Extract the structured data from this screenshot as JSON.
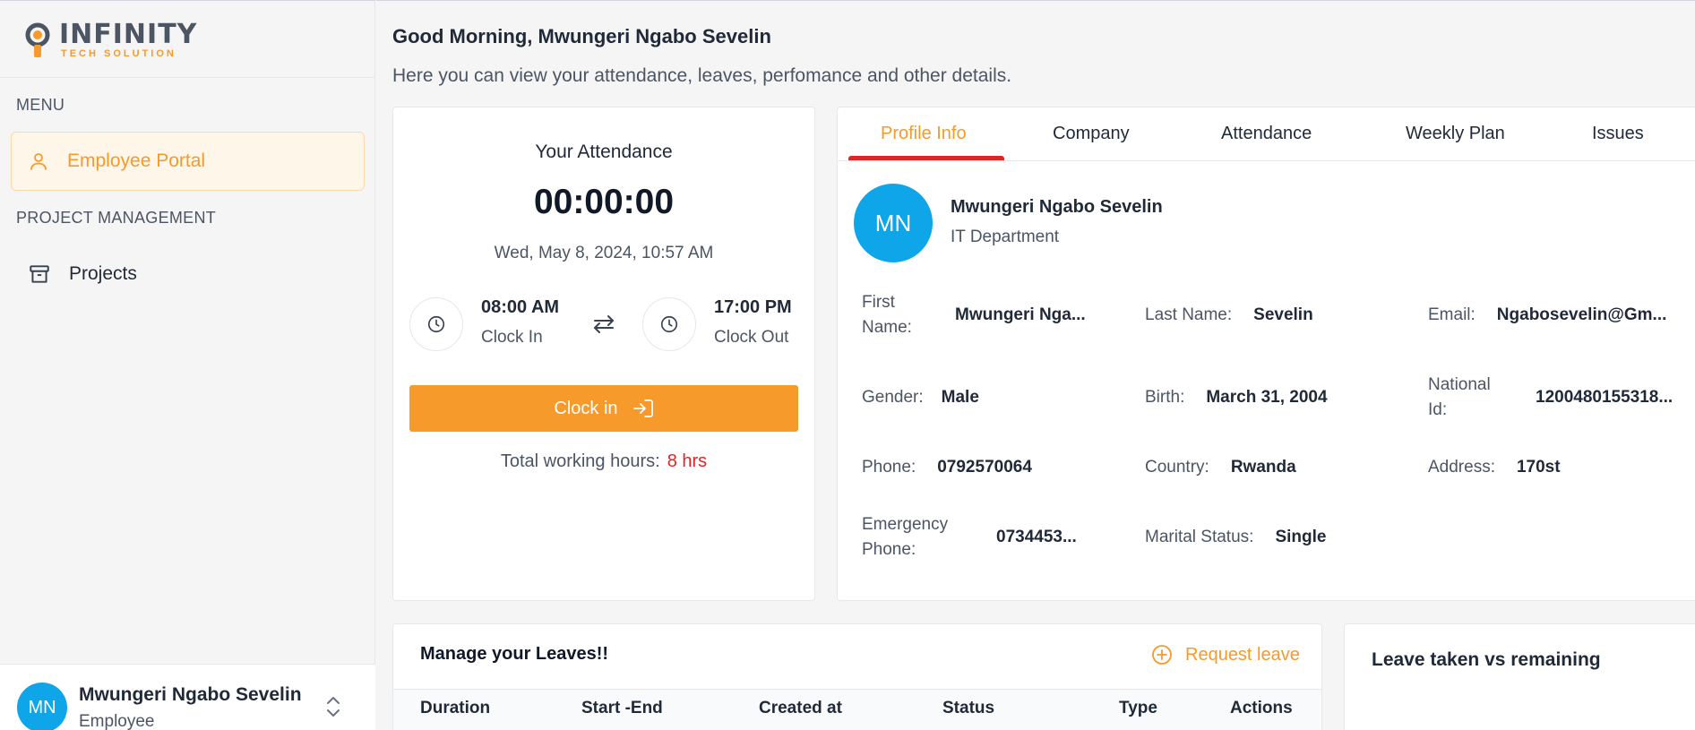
{
  "brand": {
    "name": "INFINITY",
    "tagline": "TECH SOLUTION"
  },
  "sidebar": {
    "menu_heading": "MENU",
    "project_heading": "PROJECT MANAGEMENT",
    "items": [
      {
        "label": "Employee Portal",
        "icon": "user-icon",
        "active": true
      },
      {
        "label": "Projects",
        "icon": "archive-icon",
        "active": false
      }
    ],
    "user": {
      "initials": "MN",
      "name": "Mwungeri Ngabo Sevelin",
      "role": "Employee"
    }
  },
  "header": {
    "greeting": "Good Morning, Mwungeri Ngabo Sevelin",
    "subtitle": "Here you can view your attendance, leaves, perfomance and other details."
  },
  "attendance": {
    "title": "Your Attendance",
    "timer": "00:00:00",
    "date": "Wed, May 8, 2024, 10:57 AM",
    "clock_in_time": "08:00 AM",
    "clock_in_label": "Clock In",
    "clock_out_time": "17:00 PM",
    "clock_out_label": "Clock Out",
    "button_label": "Clock in",
    "total_label": "Total working hours:",
    "total_value": "8 hrs"
  },
  "profile": {
    "tabs": [
      "Profile Info",
      "Company",
      "Attendance",
      "Weekly Plan",
      "Issues"
    ],
    "active_tab": "Profile Info",
    "initials": "MN",
    "name": "Mwungeri Ngabo Sevelin",
    "department": "IT Department",
    "fields": {
      "first_name": {
        "label": "First Name:",
        "value": "Mwungeri Nga..."
      },
      "last_name": {
        "label": "Last Name:",
        "value": "Sevelin"
      },
      "email": {
        "label": "Email:",
        "value": "Ngabosevelin@Gm..."
      },
      "gender": {
        "label": "Gender:",
        "value": "Male"
      },
      "birth": {
        "label": "Birth:",
        "value": "March 31, 2004"
      },
      "national_id": {
        "label": "National Id:",
        "value": "1200480155318..."
      },
      "phone": {
        "label": "Phone:",
        "value": "0792570064"
      },
      "country": {
        "label": "Country:",
        "value": "Rwanda"
      },
      "address": {
        "label": "Address:",
        "value": "170st"
      },
      "emergency_phone": {
        "label": "Emergency Phone:",
        "value": "0734453..."
      },
      "marital_status": {
        "label": "Marital Status:",
        "value": "Single"
      }
    }
  },
  "leaves": {
    "title": "Manage your Leaves!!",
    "request_label": "Request leave",
    "columns": [
      "Duration",
      "Start -End",
      "Created at",
      "Status",
      "Type",
      "Actions"
    ]
  },
  "leave_chart": {
    "title": "Leave taken vs remaining"
  },
  "colors": {
    "accent": "#f59a2b",
    "avatar": "#0ea5e9",
    "danger": "#dc2626"
  }
}
